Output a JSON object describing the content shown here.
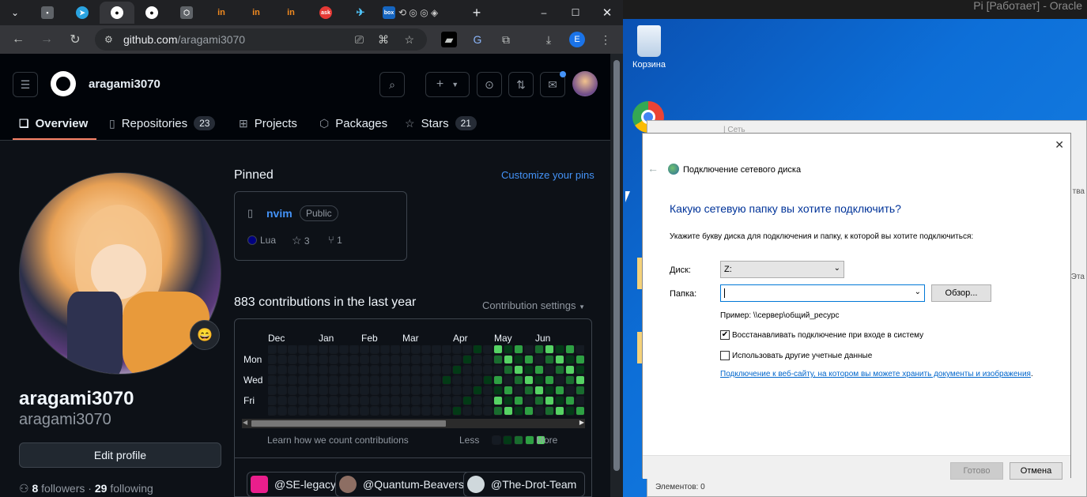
{
  "browser": {
    "tabs": [
      {
        "icon": "chevron-down-icon",
        "label": "⌄"
      },
      {
        "icon": "chat-icon",
        "label": "▪"
      },
      {
        "icon": "telegram-icon",
        "label": "➤"
      },
      {
        "icon": "github-icon",
        "label": "●"
      },
      {
        "icon": "github-icon",
        "label": "●"
      },
      {
        "icon": "openai-icon",
        "label": "⬡"
      },
      {
        "icon": "in-icon",
        "label": "in"
      },
      {
        "icon": "in-icon",
        "label": "in"
      },
      {
        "icon": "in-icon",
        "label": "in"
      },
      {
        "icon": "ask-icon",
        "label": "ask"
      },
      {
        "icon": "bird-icon",
        "label": "✈"
      },
      {
        "icon": "box-icon",
        "label": "box"
      }
    ],
    "url_host": "github.com",
    "url_path": "/aragami3070",
    "profile_initial": "E"
  },
  "github": {
    "username_header": "aragami3070",
    "nav": {
      "overview": "Overview",
      "repositories": "Repositories",
      "repositories_count": "23",
      "projects": "Projects",
      "packages": "Packages",
      "stars": "Stars",
      "stars_count": "21"
    },
    "profile": {
      "name": "aragami3070",
      "login": "aragami3070",
      "edit_button": "Edit profile",
      "followers_count": "8",
      "followers_label": "followers",
      "separator": "·",
      "following_count": "29",
      "following_label": "following",
      "status_emoji": "😄"
    },
    "pinned": {
      "heading": "Pinned",
      "customize": "Customize your pins",
      "repo_name": "nvim",
      "visibility": "Public",
      "language": "Lua",
      "language_color": "#000080",
      "stars": "3",
      "forks": "1"
    },
    "contributions": {
      "summary": "883 contributions in the last year",
      "settings": "Contribution settings",
      "months": [
        "Dec",
        "Jan",
        "Feb",
        "Mar",
        "Apr",
        "May",
        "Jun"
      ],
      "days": [
        "Mon",
        "Wed",
        "Fri"
      ],
      "learn": "Learn how we count contributions",
      "less": "Less",
      "more": "More"
    },
    "orgs": [
      "@SE-legacy",
      "@Quantum-Beavers",
      "@The-Drot-Team"
    ]
  },
  "vm": {
    "title": "Pi [Работает] - Oracle",
    "desktop": {
      "recycle_bin": "Корзина"
    },
    "dialog": {
      "title": "Подключение сетевого диска",
      "question": "Какую сетевую папку вы хотите подключить?",
      "instruction": "Укажите букву диска для подключения и папку, к которой вы хотите подключиться:",
      "drive_label": "Диск:",
      "drive_value": "Z:",
      "folder_label": "Папка:",
      "folder_value": "",
      "browse": "Обзор...",
      "example": "Пример: \\\\сервер\\общий_ресурс",
      "reconnect": "Восстанавливать подключение при входе в систему",
      "reconnect_checked": true,
      "other_creds": "Использовать другие учетные данные",
      "other_creds_checked": false,
      "link": "Подключение к веб-сайту, на котором вы можете хранить документы и изображения",
      "link_suffix": ".",
      "finish": "Готово",
      "cancel": "Отмена"
    },
    "bg_window": {
      "path": "Сеть",
      "side1": "тва",
      "side2": "Эта",
      "footer": "Элементов: 0"
    }
  }
}
